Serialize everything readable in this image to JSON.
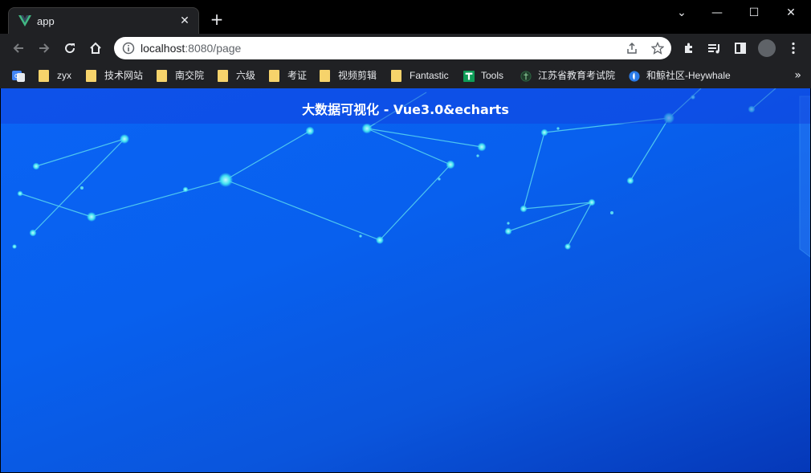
{
  "tab": {
    "title": "app",
    "close_label": "✕"
  },
  "new_tab_label": "+",
  "window_controls": {
    "minimize": "—",
    "maximize": "☐",
    "close": "✕",
    "dropdown": "⌄"
  },
  "address_bar": {
    "host": "localhost",
    "rest": ":8080/page"
  },
  "bookmarks": [
    {
      "label": "zyx",
      "icon": "folder-icon"
    },
    {
      "label": "技术网站",
      "icon": "folder-icon"
    },
    {
      "label": "南交院",
      "icon": "folder-icon"
    },
    {
      "label": "六级",
      "icon": "folder-icon"
    },
    {
      "label": "考证",
      "icon": "folder-icon"
    },
    {
      "label": "视频剪辑",
      "icon": "folder-icon"
    },
    {
      "label": "Fantastic",
      "icon": "folder-icon"
    },
    {
      "label": "Tools",
      "icon": "tools-icon"
    },
    {
      "label": "江苏省教育考试院",
      "icon": "site-icon"
    },
    {
      "label": "和鲸社区-Heywhale",
      "icon": "site-icon"
    }
  ],
  "bookmarks_more": "»",
  "page": {
    "title": "大数据可视化 - Vue3.0&echarts"
  },
  "colors": {
    "page_bg_top": "#0a64f5",
    "page_bg_bottom": "#0538b8",
    "node": "#3fe0f0",
    "line": "#5ad8f0"
  }
}
